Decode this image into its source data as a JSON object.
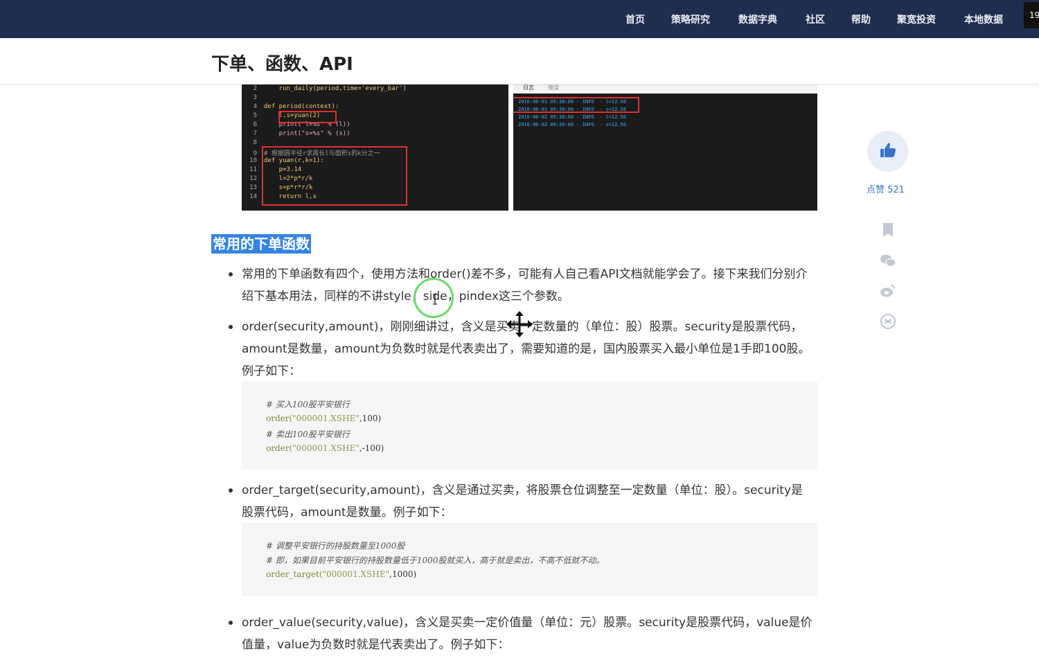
{
  "nav": {
    "items": [
      "首页",
      "策略研究",
      "数据字典",
      "社区",
      "帮助",
      "聚宽投资",
      "本地数据"
    ],
    "corner_label": "19"
  },
  "page": {
    "title": "下单、函数、API"
  },
  "screenshot_left": {
    "lines": [
      {
        "n": "2",
        "text": "    run_daily(period,time='every_bar')"
      },
      {
        "n": "3",
        "text": ""
      },
      {
        "n": "4",
        "text": "def period(context):"
      },
      {
        "n": "5",
        "text": "    l,s=yuan(2)"
      },
      {
        "n": "6",
        "text": "    print(\"l=%s\" % (l))"
      },
      {
        "n": "7",
        "text": "    print(\"s=%s\" % (s))"
      },
      {
        "n": "8",
        "text": ""
      },
      {
        "n": "9",
        "text": "# 根据圆半径r求周长l与面积s的k分之一"
      },
      {
        "n": "10",
        "text": "def yuan(r,k=1):"
      },
      {
        "n": "11",
        "text": "    p=3.14"
      },
      {
        "n": "12",
        "text": "    l=2*p*r/k"
      },
      {
        "n": "13",
        "text": "    s=p*r*r/k"
      },
      {
        "n": "14",
        "text": "    return l,s"
      }
    ]
  },
  "screenshot_right": {
    "tabs": [
      "日志",
      "错误"
    ],
    "logs": [
      "2016-06-01 09:30:00 - INFO  - l=12.56",
      "2016-06-01 09:30:00 - INFO  - s=12.56",
      "2016-06-02 09:30:00 - INFO  - l=12.56",
      "2016-06-02 09:30:00 - INFO  - s=12.56"
    ]
  },
  "section": {
    "heading": "常用的下单函数"
  },
  "bullets": [
    "常用的下单函数有四个，使用方法和order()差不多，可能有人自己看API文档就能学会了。接下来我们分别介绍下基本用法，同样的不讲style，side，pindex这三个参数。",
    "order(security,amount)，刚刚细讲过，含义是买卖一定数量的（单位：股）股票。security是股票代码，amount是数量，amount为负数时就是代表卖出了，需要知道的是，国内股票买入最小单位是1手即100股。例子如下：",
    "order_target(security,amount)，含义是通过买卖，将股票仓位调整至一定数量（单位：股）。security是股票代码，amount是数量。例子如下：",
    "order_value(security,value)，含义是买卖一定价值量（单位：元）股票。security是股票代码，value是价值量，value为负数时就是代表卖出了。例子如下："
  ],
  "code1": {
    "c1": "# 买入100股平安银行",
    "f1": "order",
    "s1": "(\"000001.XSHE\"",
    "a1": ",100)",
    "c2": "# 卖出100股平安银行",
    "f2": "order",
    "s2": "(\"000001.XSHE\"",
    "a2": ",-100)"
  },
  "code2": {
    "c1": "# 调整平安银行的持股数量至1000股",
    "c2": "# 即，如果目前平安银行的持股数量低于1000股就买入，高于就是卖出，不高不低就不动。",
    "f1": "order_target",
    "s1": "(\"000001.XSHE\"",
    "a1": ",1000)"
  },
  "rail": {
    "like_label": "点赞 521"
  }
}
